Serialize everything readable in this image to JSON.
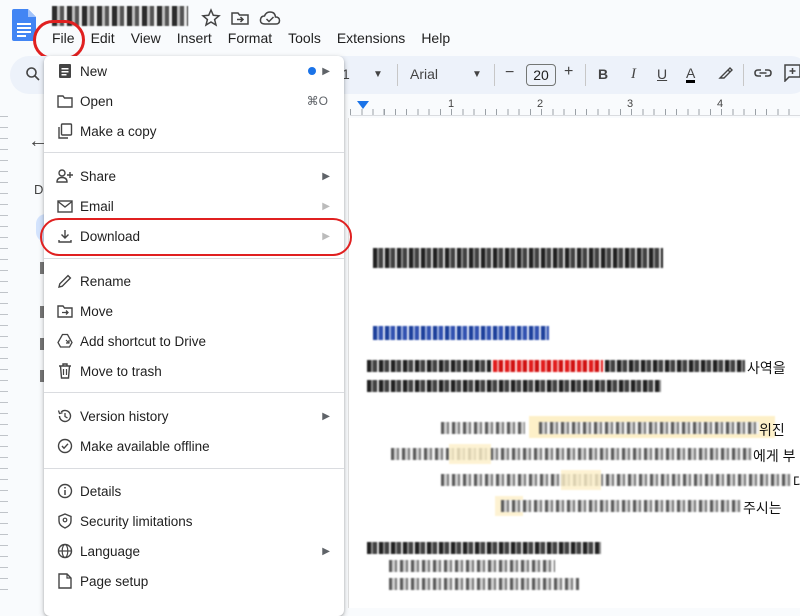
{
  "window": {
    "title": ""
  },
  "menubar": [
    "File",
    "Edit",
    "View",
    "Insert",
    "Format",
    "Tools",
    "Extensions",
    "Help"
  ],
  "toolbar": {
    "style_value": "1",
    "font": "Arial",
    "font_size": "20",
    "minus": "−",
    "plus": "+",
    "bold": "B",
    "italic": "I",
    "underline": "U",
    "text_color_letter": "A"
  },
  "ruler": {
    "numbers": [
      "1",
      "2",
      "3",
      "4"
    ]
  },
  "outline": {
    "letter": "D"
  },
  "file_menu": {
    "items": [
      {
        "label": "New",
        "icon": "document-icon",
        "submenu": true,
        "badge": true
      },
      {
        "label": "Open",
        "icon": "folder-icon",
        "shortcut": "⌘O"
      },
      {
        "label": "Make a copy",
        "icon": "copy-icon"
      },
      {
        "label": "Share",
        "icon": "person-add-icon",
        "submenu": true
      },
      {
        "label": "Email",
        "icon": "email-icon",
        "submenu": true
      },
      {
        "label": "Download",
        "icon": "download-icon",
        "submenu": true
      },
      {
        "label": "Rename",
        "icon": "pencil-icon"
      },
      {
        "label": "Move",
        "icon": "move-folder-icon"
      },
      {
        "label": "Add shortcut to Drive",
        "icon": "drive-shortcut-icon"
      },
      {
        "label": "Move to trash",
        "icon": "trash-icon"
      },
      {
        "label": "Version history",
        "icon": "history-icon",
        "submenu": true
      },
      {
        "label": "Make available offline",
        "icon": "offline-check-icon"
      },
      {
        "label": "Details",
        "icon": "info-icon"
      },
      {
        "label": "Security limitations",
        "icon": "shield-icon"
      },
      {
        "label": "Language",
        "icon": "globe-icon",
        "submenu": true
      },
      {
        "label": "Page setup",
        "icon": "page-icon"
      }
    ]
  },
  "colors": {
    "accent": "#1a73e8",
    "highlight": "#e02020",
    "docs_blue": "#4285f4"
  }
}
